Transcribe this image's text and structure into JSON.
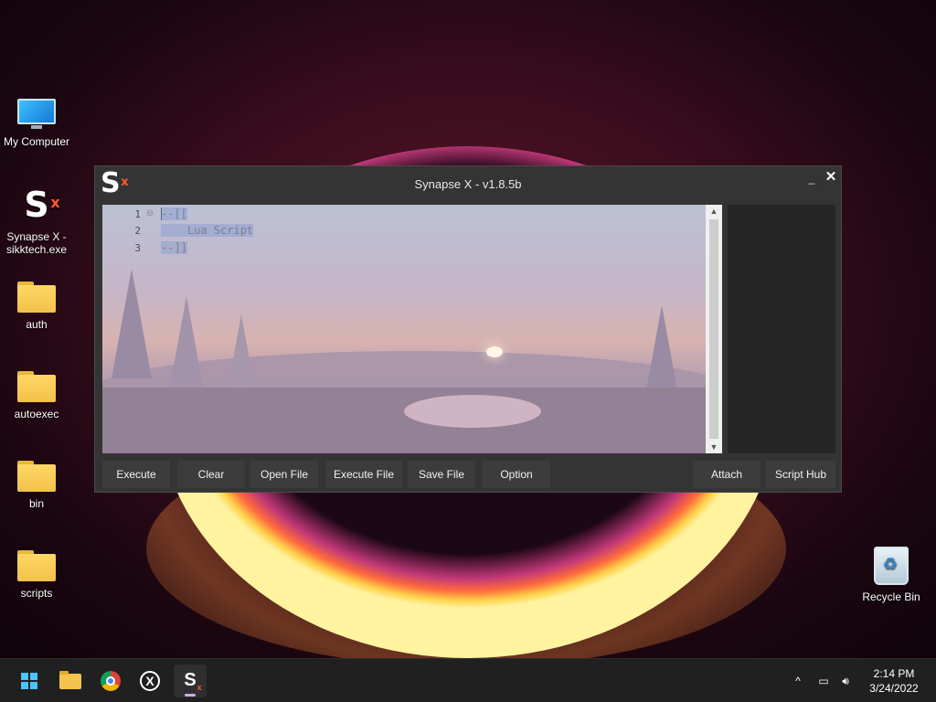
{
  "desktop": {
    "icons": [
      {
        "label": "My Computer"
      },
      {
        "label": "Synapse X -\nsikktech.exe"
      },
      {
        "label": "auth"
      },
      {
        "label": "autoexec"
      },
      {
        "label": "bin"
      },
      {
        "label": "scripts"
      },
      {
        "label": "Recycle Bin"
      }
    ]
  },
  "window": {
    "title": "Synapse X - v1.8.5b",
    "logo_text": "S",
    "logo_sup": "x",
    "minimize_glyph": "_",
    "close_glyph": "✕",
    "editor": {
      "line_numbers": [
        "1",
        "2",
        "3"
      ],
      "lines": [
        "--[[",
        "    Lua Script",
        "--]]"
      ]
    },
    "buttons": {
      "execute": "Execute",
      "clear": "Clear",
      "open_file": "Open File",
      "execute_file": "Execute File",
      "save_file": "Save File",
      "option": "Option",
      "attach": "Attach",
      "script_hub": "Script Hub"
    }
  },
  "taskbar": {
    "apps": [
      "start-icon",
      "file-explorer-icon",
      "chrome-icon",
      "xbox-icon",
      "synapse-icon"
    ],
    "tray": {
      "chevron": "^",
      "time": "2:14 PM",
      "date": "3/24/2022"
    }
  },
  "colors": {
    "accent_x": "#ff5a2a",
    "window_bg": "#343434",
    "taskbar_bg": "#202020"
  }
}
